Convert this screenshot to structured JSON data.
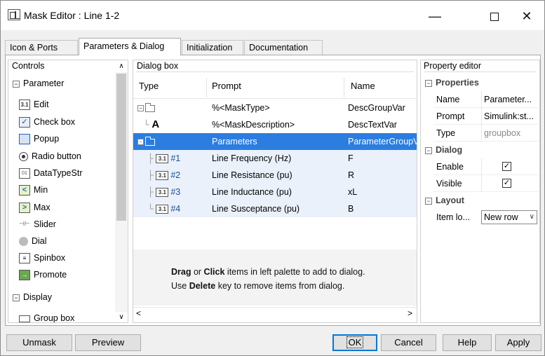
{
  "window": {
    "title": "Mask Editor : Line 1-2",
    "minimize": "—",
    "close": "✕"
  },
  "tabs": [
    {
      "label": "Icon & Ports"
    },
    {
      "label": "Parameters & Dialog"
    },
    {
      "label": "Initialization"
    },
    {
      "label": "Documentation"
    }
  ],
  "controls": {
    "header": "Controls",
    "sections": {
      "parameter": "Parameter",
      "display": "Display"
    },
    "items": [
      {
        "label": "Edit",
        "icon": "edit-icon"
      },
      {
        "label": "Check box",
        "icon": "checkbox-icon"
      },
      {
        "label": "Popup",
        "icon": "popup-icon"
      },
      {
        "label": "Radio button",
        "icon": "radio-button-icon"
      },
      {
        "label": "DataTypeStr",
        "icon": "datatype-icon"
      },
      {
        "label": "Min",
        "icon": "min-icon"
      },
      {
        "label": "Max",
        "icon": "max-icon"
      },
      {
        "label": "Slider",
        "icon": "slider-icon"
      },
      {
        "label": "Dial",
        "icon": "dial-icon"
      },
      {
        "label": "Spinbox",
        "icon": "spinbox-icon"
      },
      {
        "label": "Promote",
        "icon": "promote-icon"
      }
    ],
    "display_items": [
      {
        "label": "Group box",
        "icon": "groupbox-icon"
      }
    ]
  },
  "dialog_box": {
    "header": "Dialog box",
    "columns": {
      "type": "Type",
      "prompt": "Prompt",
      "name": "Name"
    },
    "rows": [
      {
        "num": "",
        "prompt": "%<MaskType>",
        "name": "DescGroupVar"
      },
      {
        "num": "",
        "glyph": "A",
        "prompt": "%<MaskDescription>",
        "name": "DescTextVar"
      },
      {
        "num": "",
        "prompt": "Parameters",
        "name": "ParameterGroupVar"
      },
      {
        "num": "#1",
        "prompt": "Line Frequency (Hz)",
        "name": "F"
      },
      {
        "num": "#2",
        "prompt": "Line Resistance (pu)",
        "name": "R"
      },
      {
        "num": "#3",
        "prompt": "Line Inductance (pu)",
        "name": "xL"
      },
      {
        "num": "#4",
        "prompt": "Line Susceptance (pu)",
        "name": "B"
      }
    ],
    "hint": {
      "line1_a": "Drag",
      "line1_b": " or ",
      "line1_c": "Click",
      "line1_d": " items in left palette to add to dialog.",
      "line2_a": "Use ",
      "line2_b": "Delete",
      "line2_c": " key to remove items from dialog."
    }
  },
  "property_editor": {
    "header": "Property editor",
    "properties": {
      "title": "Properties",
      "name_key": "Name",
      "name_val": "Parameter...",
      "prompt_key": "Prompt",
      "prompt_val": "Simulink:st...",
      "type_key": "Type",
      "type_val": "groupbox"
    },
    "dialog": {
      "title": "Dialog",
      "enable_key": "Enable",
      "enable_checked": true,
      "visible_key": "Visible",
      "visible_checked": true
    },
    "layout": {
      "title": "Layout",
      "item_key": "Item lo...",
      "item_val": "New row"
    }
  },
  "buttons": {
    "unmask": "Unmask",
    "preview": "Preview",
    "ok": "OK",
    "cancel": "Cancel",
    "help": "Help",
    "apply": "Apply"
  },
  "colors": {
    "selection": "#2b7de0",
    "highlight": "#eaf1fb",
    "accent": "#0078d7"
  }
}
